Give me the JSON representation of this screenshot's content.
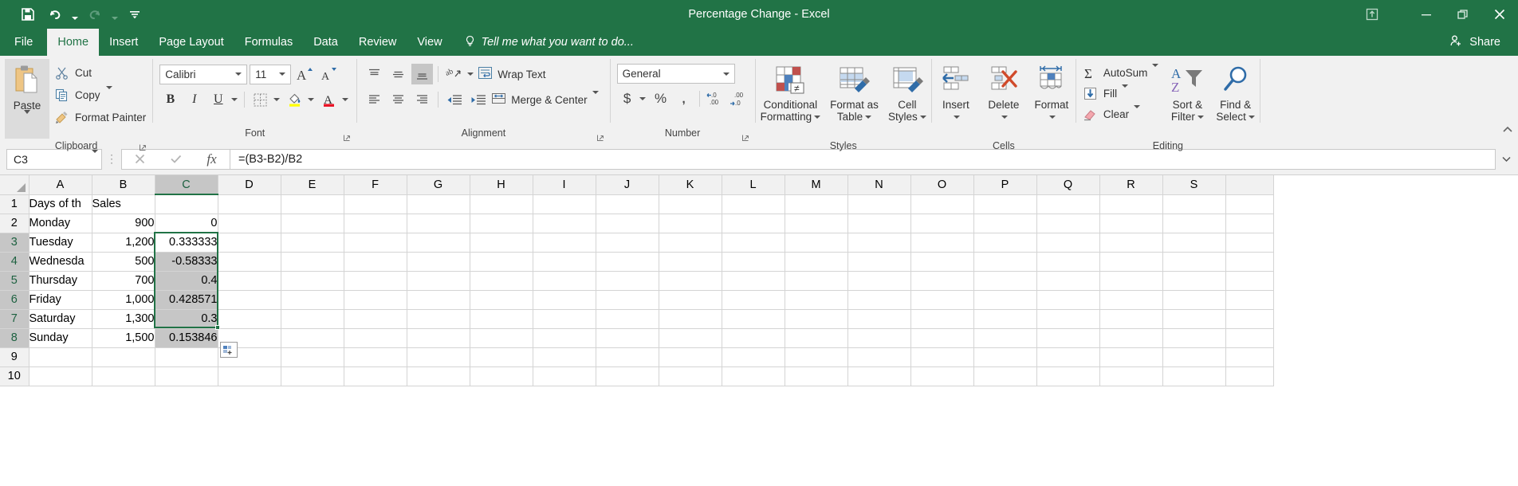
{
  "titlebar": {
    "document_title": "Percentage Change - Excel",
    "quick_access": [
      {
        "name": "save",
        "icon": "save-icon"
      },
      {
        "name": "undo",
        "icon": "undo-icon",
        "has_caret": true
      },
      {
        "name": "redo",
        "icon": "redo-icon",
        "has_caret": true,
        "disabled": true
      },
      {
        "name": "customize-qat",
        "icon": "customize-quick-access-toolbar-icon"
      }
    ],
    "ribbon_display_options": "ribbon-display-options-icon",
    "minimize": "minimize-icon",
    "restore": "restore-icon",
    "close": "close-icon"
  },
  "tabs": [
    {
      "label": "File",
      "active": false
    },
    {
      "label": "Home",
      "active": true
    },
    {
      "label": "Insert",
      "active": false
    },
    {
      "label": "Page Layout",
      "active": false
    },
    {
      "label": "Formulas",
      "active": false
    },
    {
      "label": "Data",
      "active": false
    },
    {
      "label": "Review",
      "active": false
    },
    {
      "label": "View",
      "active": false
    }
  ],
  "tell_me": "Tell me what you want to do...",
  "share_label": "Share",
  "ribbon": {
    "clipboard": {
      "group_label": "Clipboard",
      "paste_label": "Paste",
      "items": [
        {
          "label": "Cut",
          "icon": "scissors-icon"
        },
        {
          "label": "Copy",
          "icon": "copy-icon"
        },
        {
          "label": "Format Painter",
          "icon": "format-painter-icon"
        }
      ]
    },
    "font": {
      "group_label": "Font",
      "font_name": "Calibri",
      "font_size": "11",
      "grow_font": "A",
      "shrink_font": "A",
      "bold": "B",
      "italic": "I",
      "underline": "U",
      "borders_icon": "borders-icon",
      "fill_color_icon": "fill-color-icon",
      "font_color_icon": "font-color-icon"
    },
    "alignment": {
      "group_label": "Alignment",
      "wrap_text": "Wrap Text",
      "merge_center": "Merge & Center",
      "orientation_icon": "orientation-icon",
      "align_top": "align-top-icon",
      "align_middle": "align-middle-icon",
      "align_bottom": "align-bottom-icon",
      "align_left": "align-left-icon",
      "align_center": "align-center-icon",
      "align_right": "align-right-icon",
      "decrease_indent": "decrease-indent-icon",
      "increase_indent": "increase-indent-icon"
    },
    "number": {
      "group_label": "Number",
      "format": "General",
      "accounting": "$",
      "percent": "%",
      "comma": ",",
      "increase_decimal": ".00",
      "decrease_decimal": ".0"
    },
    "styles": {
      "group_label": "Styles",
      "buttons": [
        {
          "line1": "Conditional",
          "line2": "Formatting",
          "icon": "conditional-formatting-icon"
        },
        {
          "line1": "Format as",
          "line2": "Table",
          "icon": "format-as-table-icon"
        },
        {
          "line1": "Cell",
          "line2": "Styles",
          "icon": "cell-styles-icon"
        }
      ]
    },
    "cells": {
      "group_label": "Cells",
      "buttons": [
        {
          "line1": "Insert",
          "line2": "",
          "icon": "insert-cells-icon"
        },
        {
          "line1": "Delete",
          "line2": "",
          "icon": "delete-cells-icon"
        },
        {
          "line1": "Format",
          "line2": "",
          "icon": "format-cells-icon"
        }
      ]
    },
    "editing": {
      "group_label": "Editing",
      "items": [
        {
          "label": "AutoSum",
          "icon": "autosum-icon"
        },
        {
          "label": "Fill",
          "icon": "fill-icon"
        },
        {
          "label": "Clear",
          "icon": "clear-icon"
        }
      ],
      "sort_filter": {
        "line1": "Sort &",
        "line2": "Filter",
        "icon": "sort-filter-icon"
      },
      "find_select": {
        "line1": "Find &",
        "line2": "Select",
        "icon": "find-select-icon"
      }
    }
  },
  "formula_bar": {
    "name_box": "C3",
    "cancel_icon": "cancel-icon",
    "enter_icon": "confirm-icon",
    "function_icon": "insert-function-icon",
    "formula": "=(B3-B2)/B2"
  },
  "grid": {
    "column_headers": [
      "A",
      "B",
      "C",
      "D",
      "E",
      "F",
      "G",
      "H",
      "I",
      "J",
      "K",
      "L",
      "M",
      "N",
      "O",
      "P",
      "Q",
      "R",
      "S"
    ],
    "selected_column": "C",
    "row_headers": [
      "1",
      "2",
      "3",
      "4",
      "5",
      "6",
      "7",
      "8",
      "9",
      "10"
    ],
    "selected_rows": [
      "3",
      "4",
      "5",
      "6",
      "7",
      "8"
    ],
    "rows": [
      {
        "num": "1",
        "a": "Days of th",
        "b": "Sales",
        "c": ""
      },
      {
        "num": "2",
        "a": "Monday",
        "b": "900",
        "c": "0"
      },
      {
        "num": "3",
        "a": "Tuesday",
        "b": "1,200",
        "c": "0.333333"
      },
      {
        "num": "4",
        "a": "Wednesda",
        "b": "500",
        "c": "-0.58333"
      },
      {
        "num": "5",
        "a": "Thursday",
        "b": "700",
        "c": "0.4"
      },
      {
        "num": "6",
        "a": "Friday",
        "b": "1,000",
        "c": "0.428571"
      },
      {
        "num": "7",
        "a": " Saturday",
        "b": "1,300",
        "c": "0.3"
      },
      {
        "num": "8",
        "a": "Sunday",
        "b": "1,500",
        "c": "0.153846"
      },
      {
        "num": "9",
        "a": "",
        "b": "",
        "c": ""
      },
      {
        "num": "10",
        "a": "",
        "b": "",
        "c": ""
      }
    ],
    "selection_range": "C3:C8",
    "active_cell": "C3",
    "autofill_options_icon": "auto-fill-options-icon"
  },
  "colors": {
    "excel_green": "#217346",
    "ribbon_bg": "#f1f1f1",
    "selection_border": "#217346",
    "selection_shade": "#c6c6c6"
  }
}
